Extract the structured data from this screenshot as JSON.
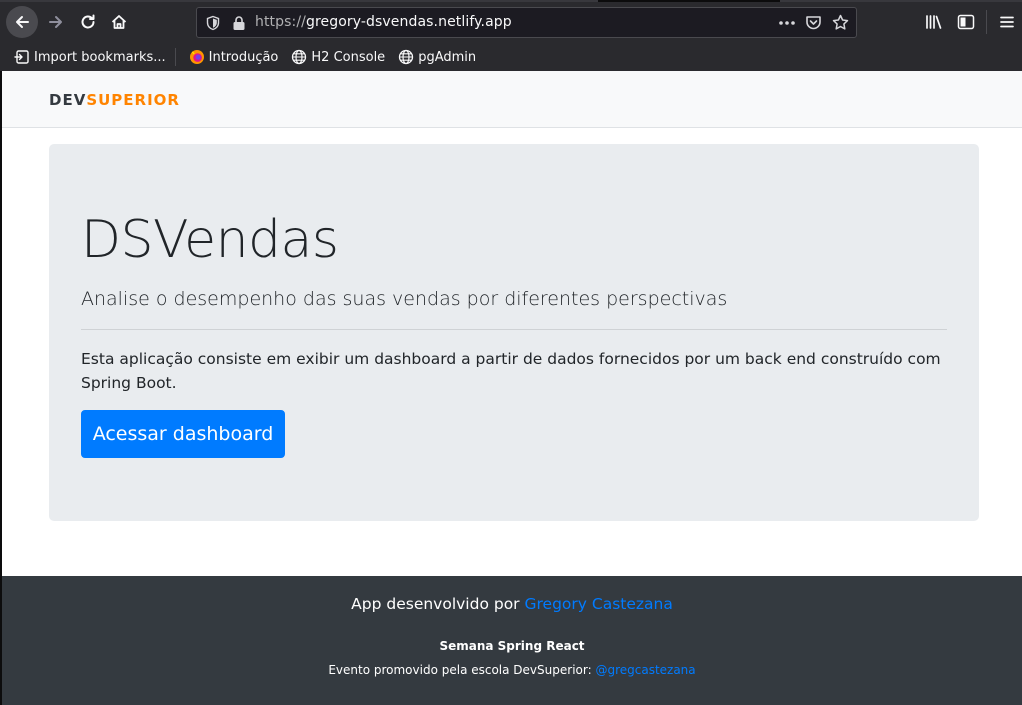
{
  "browser": {
    "url_prefix": "https://",
    "url_host": "gregory-dsvendas.netlify.app",
    "bookmarks": [
      {
        "label": "Import bookmarks...",
        "icon": "import-icon"
      },
      {
        "label": "Introdução",
        "icon": "firefox-icon"
      },
      {
        "label": "H2 Console",
        "icon": "globe-icon"
      },
      {
        "label": "pgAdmin",
        "icon": "globe-icon"
      }
    ]
  },
  "navbar": {
    "logo_dev": "DEV",
    "logo_superior": "SUPERIOR"
  },
  "jumbotron": {
    "title": "DSVendas",
    "lead": "Analise o desempenho das suas vendas por diferentes perspectivas",
    "description": "Esta aplicação consiste em exibir um dashboard a partir de dados fornecidos por um back end construído com Spring Boot.",
    "cta_label": "Acessar dashboard"
  },
  "footer": {
    "line1_prefix": "App desenvolvido por ",
    "author": "Gregory Castezana",
    "line2": "Semana Spring React",
    "line3_prefix": "Evento promovido pela escola DevSuperior: ",
    "handle": "@gregcastezana"
  },
  "colors": {
    "brand_orange": "#ff8400",
    "primary_blue": "#007bff",
    "footer_bg": "#343a40",
    "jumbotron_bg": "#e9ecef"
  }
}
